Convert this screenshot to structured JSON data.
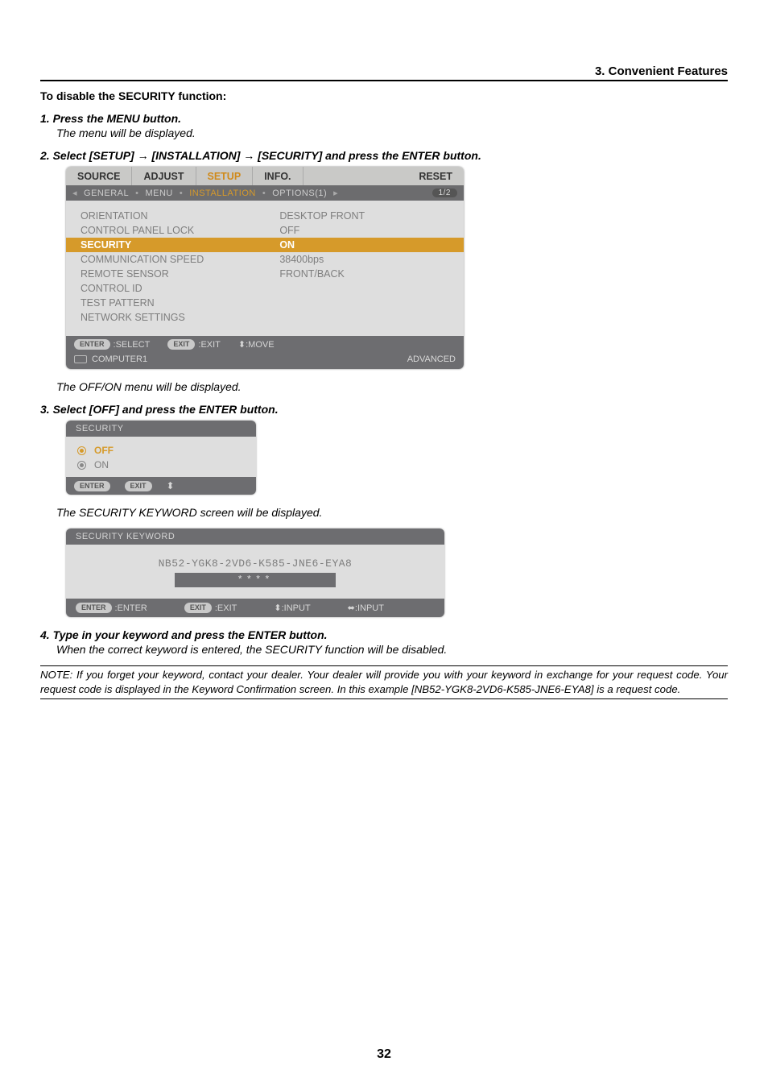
{
  "section_header": "3. Convenient Features",
  "intro_heading": "To disable the SECURITY function:",
  "steps": {
    "s1": {
      "title": "1.  Press the MENU button.",
      "desc": "The menu will be displayed."
    },
    "s2": {
      "title": "2.  Select [SETUP] → [INSTALLATION] → [SECURITY] and press the ENTER button.",
      "desc": "The OFF/ON menu will be displayed."
    },
    "s3": {
      "title": "3.  Select [OFF] and press the ENTER button.",
      "desc": "The SECURITY KEYWORD screen will be displayed."
    },
    "s4": {
      "title": "4.  Type in your keyword and press the ENTER button.",
      "desc": "When the correct keyword is entered, the SECURITY function will be disabled."
    }
  },
  "setup_panel": {
    "tabs": {
      "source": "SOURCE",
      "adjust": "ADJUST",
      "setup": "SETUP",
      "info": "INFO.",
      "reset": "RESET"
    },
    "subtabs": {
      "arrowL": "◂",
      "general": "GENERAL",
      "menu": "MENU",
      "installation": "INSTALLATION",
      "options1": "OPTIONS(1)",
      "arrowR": "▸",
      "page": "1/2"
    },
    "rows": {
      "orientation": {
        "label": "ORIENTATION",
        "value": "DESKTOP FRONT"
      },
      "control_panel_lock": {
        "label": "CONTROL PANEL LOCK",
        "value": "OFF"
      },
      "security": {
        "label": "SECURITY",
        "value": "ON"
      },
      "comm_speed": {
        "label": "COMMUNICATION SPEED",
        "value": "38400bps"
      },
      "remote_sensor": {
        "label": "REMOTE SENSOR",
        "value": "FRONT/BACK"
      },
      "control_id": {
        "label": "CONTROL ID",
        "value": ""
      },
      "test_pattern": {
        "label": "TEST PATTERN",
        "value": ""
      },
      "network_settings": {
        "label": "NETWORK SETTINGS",
        "value": ""
      }
    },
    "footer1": {
      "enter_pill": "ENTER",
      "select": ":SELECT",
      "exit_pill": "EXIT",
      "exit": ":EXIT",
      "move": "⬍:MOVE"
    },
    "footer2": {
      "src": "COMPUTER1",
      "mode": "ADVANCED"
    }
  },
  "security_dialog": {
    "title": "SECURITY",
    "off": "OFF",
    "on": "ON",
    "enter_pill": "ENTER",
    "exit_pill": "EXIT",
    "updn": "⬍"
  },
  "keyword_dialog": {
    "title": "SECURITY KEYWORD",
    "code": "NB52-YGK8-2VD6-K585-JNE6-EYA8",
    "masked": "****",
    "footer": {
      "enter_pill": "ENTER",
      "enter": ":ENTER",
      "exit_pill": "EXIT",
      "exit": ":EXIT",
      "inputV": "⬍:INPUT",
      "inputH": "⬌:INPUT"
    }
  },
  "note_text": "NOTE: If you forget your keyword, contact your dealer. Your dealer will provide you with your keyword in exchange for your request code. Your request code is displayed in the Keyword Confirmation screen. In this example [NB52-YGK8-2VD6-K585-JNE6-EYA8] is a request code.",
  "page_number": "32"
}
